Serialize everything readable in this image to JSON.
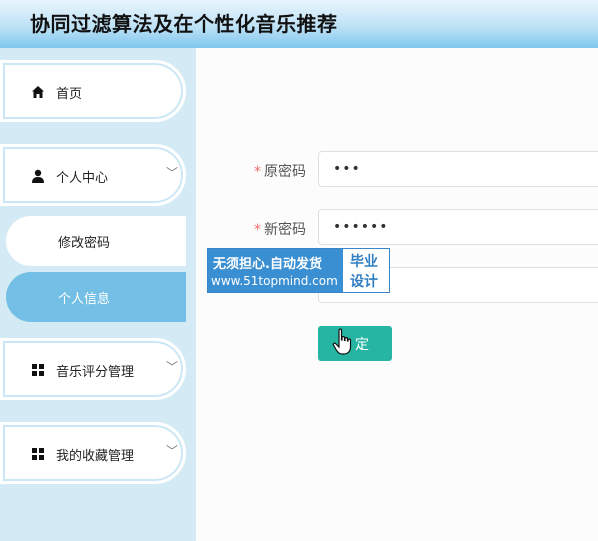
{
  "header": {
    "title": "协同过滤算法及在个性化音乐推荐"
  },
  "sidebar": {
    "home": {
      "label": "首页",
      "icon": "home-icon"
    },
    "personal_center": {
      "label": "个人中心",
      "icon": "user-icon"
    },
    "sub_items": [
      {
        "label": "修改密码",
        "active": false
      },
      {
        "label": "个人信息",
        "active": true
      }
    ],
    "music_rating": {
      "label": "音乐评分管理",
      "icon": "grid-icon"
    },
    "my_favorites": {
      "label": "我的收藏管理",
      "icon": "grid-icon"
    }
  },
  "form": {
    "required_mark": "*",
    "old_password": {
      "label": "原密码",
      "value": "•••"
    },
    "new_password": {
      "label": "新密码",
      "value": "••••••"
    },
    "confirm_password": {
      "value": ""
    },
    "submit_label": "定"
  },
  "watermark": {
    "line1": "无须担心.自动发货",
    "line2": "www.51topmind.com",
    "right1": "毕业",
    "right2": "设计"
  },
  "colors": {
    "accent": "#26b5a2",
    "sidebar_bg": "#d4ebf5",
    "active_item": "#73bfe5"
  }
}
